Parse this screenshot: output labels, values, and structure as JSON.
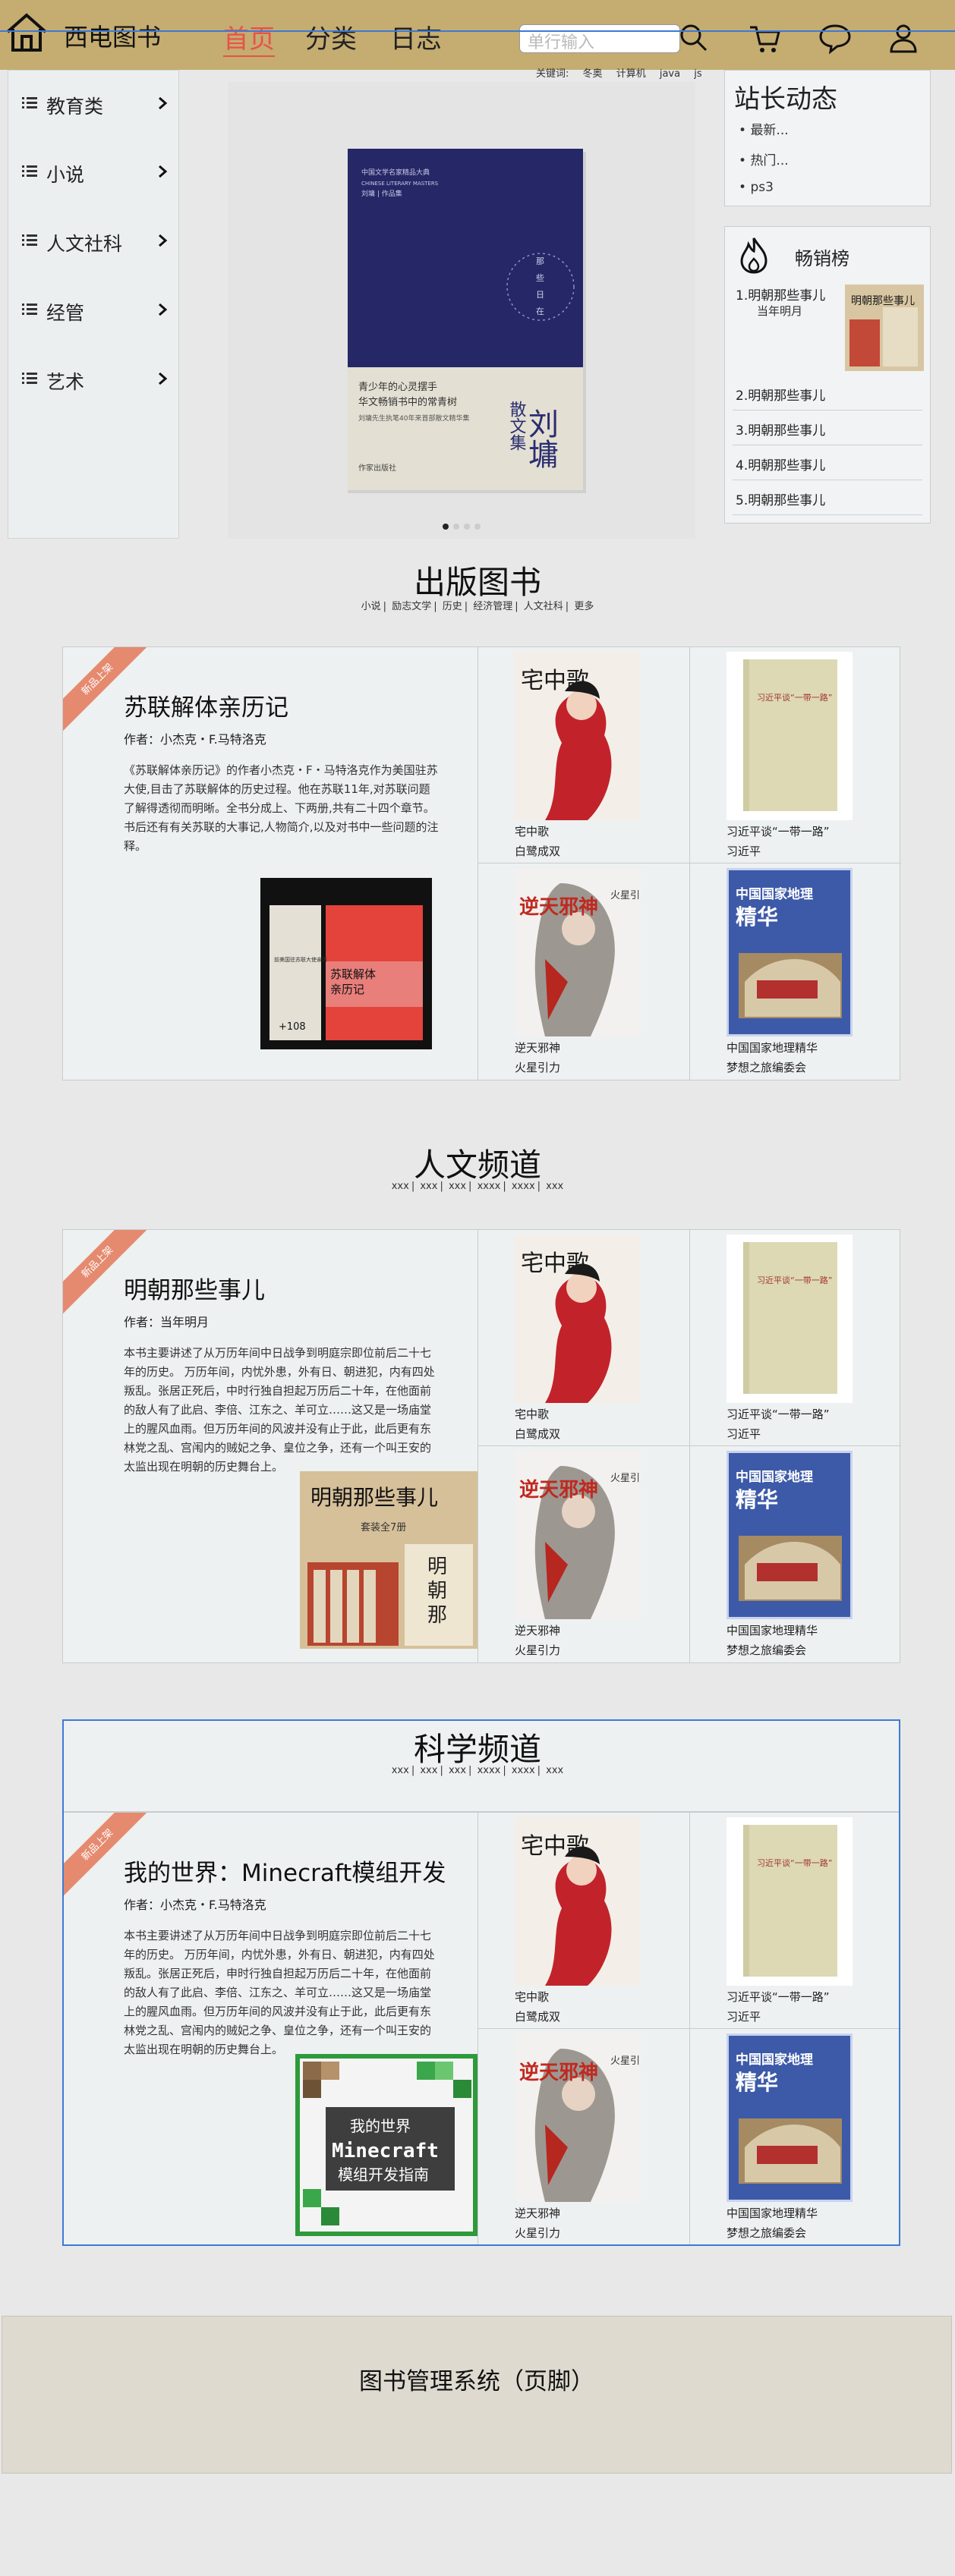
{
  "header": {
    "brand": "西电图书",
    "nav": [
      "首页",
      "分类",
      "日志"
    ],
    "search_placeholder": "单行输入",
    "accent_color": "#e8524a",
    "icons": [
      "home-icon",
      "search-icon",
      "cart-icon",
      "chat-icon",
      "user-icon"
    ]
  },
  "sidebar": {
    "items": [
      "教育类",
      "小说",
      "人文社科",
      "经管",
      "艺术"
    ]
  },
  "carousel": {
    "keywords_label": "关键词:",
    "keywords": [
      "冬奥",
      "计算机",
      "java",
      "js"
    ],
    "book": {
      "series": "中国文学名家精品大典",
      "series_en": "CHINESE LITERARY MASTERS",
      "series2": "刘墉 | 作品集",
      "line1": "青少年的心灵摆手",
      "line2": "华文畅销书中的常青树",
      "line3": "刘墉先生执笔40年来首部散文精华集",
      "circle_text": [
        "那",
        "些",
        "日",
        "在"
      ],
      "author": "刘墉",
      "genre": "散文集",
      "publisher": "作家出版社"
    }
  },
  "news": {
    "title": "站长动态",
    "items": [
      "最新...",
      "热门...",
      "ps3"
    ]
  },
  "ranking": {
    "title": "畅销榜",
    "first": "1.明朝那些事儿",
    "first_sub": "当年明月",
    "rows": [
      "2.明朝那些事儿",
      "3.明朝那些事儿",
      "4.明朝那些事儿",
      "5.明朝那些事儿"
    ]
  },
  "sections": [
    {
      "title": "出版图书",
      "subnav": [
        "小说",
        "励志文学",
        "历史",
        "经济管理",
        "人文社科",
        "更多"
      ],
      "ribbon": "新品上架",
      "feature_title": "苏联解体亲历记",
      "feature_author": "作者：小杰克・F.马特洛克",
      "feature_desc": "《苏联解体亲历记》的作者小杰克・F・马特洛克作为美国驻苏大使,目击了苏联解体的历史过程。他在苏联11年,对苏联问题了解得透彻而明晰。全书分成上、下两册,共有二十四个章节。书后还有有关苏联的大事记,人物简介,以及对书中一些问题的注释。",
      "feature_cover": "ussr",
      "cover_text": [
        "苏联解体",
        "亲历记",
        "前美国驻苏联大使亲历",
        "+108"
      ]
    },
    {
      "title": "人文频道",
      "subnav": [
        "xxx",
        "xxx",
        "xxx",
        "xxxx",
        "xxxx",
        "xxx"
      ],
      "ribbon": "新品上架",
      "feature_title": "明朝那些事儿",
      "feature_author": "作者：当年明月",
      "feature_desc": "本书主要讲述了从万历年间中日战争到明庭宗即位前后二十七年的历史。 万历年间，内忧外患，外有日、朝进犯，内有四处叛乱。张居正死后，中时行独自担起万历后二十年，在他面前的敌人有了此启、李倍、江东之、羊可立……这又是一场庙堂上的腥风血雨。但万历年间的风波并没有止于此，此后更有东林党之乱、宫闱内的贼妃之争、皇位之争，还有一个叫王安的太监出现在明朝的历史舞台上。",
      "feature_cover": "ming",
      "cover_text": [
        "明朝那些事儿",
        "套装全7册",
        "明",
        "朝",
        "那"
      ]
    },
    {
      "title": "科学频道",
      "subnav": [
        "xxx",
        "xxx",
        "xxx",
        "xxxx",
        "xxxx",
        "xxx"
      ],
      "ribbon": "新品上架",
      "feature_title": "我的世界：Minecraft模组开发",
      "feature_author": "作者：小杰克・F.马特洛克",
      "feature_desc": "本书主要讲述了从万历年间中日战争到明庭宗即位前后二十七年的历史。 万历年间，内忧外患，外有日、朝进犯，内有四处叛乱。张居正死后，申时行独自担起万历后二十年，在他面前的敌人有了此启、李倍、江东之、羊可立……这又是一场庙堂上的腥风血雨。但万历年间的风波并没有止于此，此后更有东林党之乱、宫闱内的贼妃之争、皇位之争，还有一个叫王安的太监出现在明朝的历史舞台上。",
      "feature_cover": "mc",
      "cover_text": [
        "我的世界",
        "Minecraft",
        "模组开发指南"
      ]
    }
  ],
  "grid_books": [
    {
      "cap1": "宅中歌",
      "cap2": "白鹭成双",
      "art": "zzg",
      "cover": "宅中歌"
    },
    {
      "cap1": "习近平谈“一带一路”",
      "cap2": "习近平",
      "art": "xjp",
      "cover": "习近平谈“一带一路”"
    },
    {
      "cap1": "逆天邪神",
      "cap2": "火星引力",
      "art": "ntxs",
      "cover": "逆天邪神",
      "cover_sub": "火星引力"
    },
    {
      "cap1": "中国国家地理精华",
      "cap2": "梦想之旅编委会",
      "art": "geo",
      "cover": "中国国家地理",
      "cover_sub": "精华"
    }
  ],
  "footer": {
    "text": "图书管理系统（页脚）"
  }
}
